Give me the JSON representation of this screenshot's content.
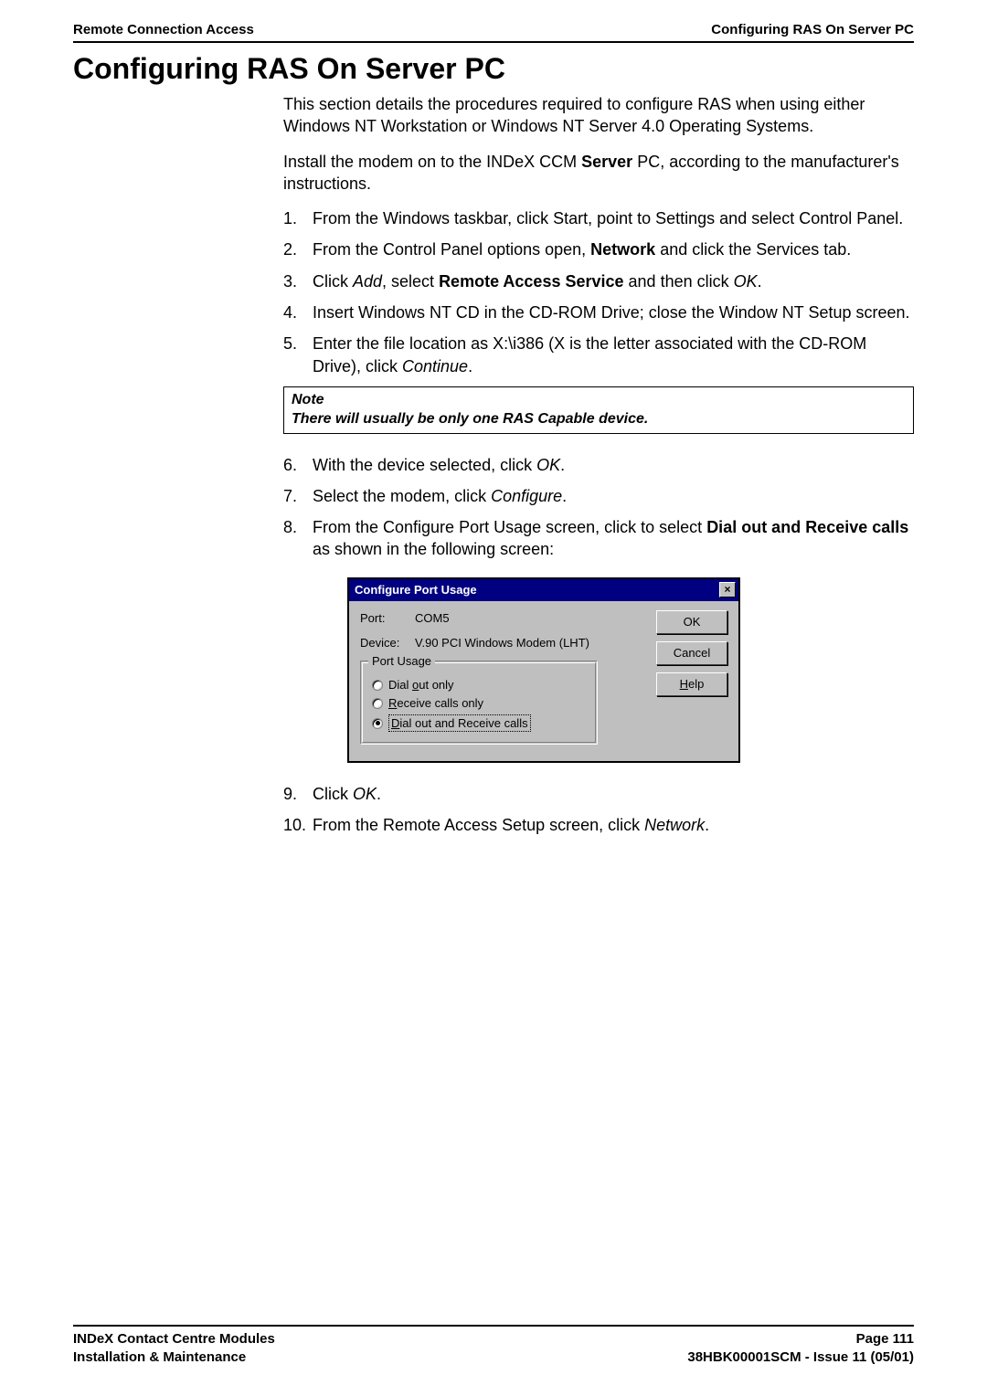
{
  "header": {
    "left": "Remote Connection Access",
    "right": "Configuring RAS On Server PC"
  },
  "h1": "Configuring RAS On Server PC",
  "intro1": "This section details the procedures required to configure RAS when using either Windows NT Workstation or Windows NT Server 4.0 Operating Systems.",
  "intro2_pre": "Install the modem on to the INDeX CCM ",
  "intro2_bold": "Server",
  "intro2_post": " PC, according to the manufacturer's instructions.",
  "steps_a": [
    {
      "n": "1.",
      "text": "From the Windows taskbar, click Start, point to Settings and select Control Panel."
    },
    {
      "n": "2.",
      "pre": "From the Control Panel options open, ",
      "bold": "Network",
      "post": " and click the Services tab."
    },
    {
      "n": "3.",
      "pre": "Click ",
      "it1": "Add",
      "mid1": ", select ",
      "bold": "Remote Access Service",
      "mid2": " and then click ",
      "it2": "OK",
      "post": "."
    },
    {
      "n": "4.",
      "text": "Insert Windows NT CD in the CD-ROM Drive; close the Window NT Setup screen."
    },
    {
      "n": "5.",
      "pre": "Enter the file location as X:\\i386 (X is the letter associated with the CD-ROM Drive), click ",
      "it1": "Continue",
      "post": "."
    }
  ],
  "note": {
    "title": "Note",
    "body": "There will usually be only one RAS Capable device."
  },
  "steps_b": [
    {
      "n": "6.",
      "pre": "With the device selected, click ",
      "it1": "OK",
      "post": "."
    },
    {
      "n": "7.",
      "pre": "Select the modem, click ",
      "it1": "Configure",
      "post": "."
    },
    {
      "n": "8.",
      "pre": "From the Configure Port Usage screen, click to select ",
      "bold": "Dial out and Receive calls",
      "post": " as shown in the following screen:"
    }
  ],
  "dialog": {
    "title": "Configure Port Usage",
    "close_glyph": "×",
    "port_label": "Port:",
    "port_value": "COM5",
    "device_label": "Device:",
    "device_value": "V.90 PCI Windows Modem (LHT)",
    "group_title": "Port Usage",
    "opts": {
      "opt1_mn": "o",
      "opt1_pre": "Dial ",
      "opt1_post": "ut only",
      "opt2_mn": "R",
      "opt2_post": "eceive calls only",
      "opt3_mn": "D",
      "opt3_post": "ial out and Receive calls"
    },
    "btn_ok": "OK",
    "btn_cancel": "Cancel",
    "btn_help_mn": "H",
    "btn_help_rest": "elp"
  },
  "steps_c": [
    {
      "n": "9.",
      "pre": "Click ",
      "it1": "OK",
      "post": "."
    },
    {
      "n": "10.",
      "pre": "From the Remote Access Setup screen, click ",
      "it1": "Network",
      "post": "."
    }
  ],
  "footer": {
    "left1": "INDeX Contact Centre Modules",
    "left2": "Installation & Maintenance",
    "right1": "Page 111",
    "right2": "38HBK00001SCM - Issue 11 (05/01)"
  }
}
